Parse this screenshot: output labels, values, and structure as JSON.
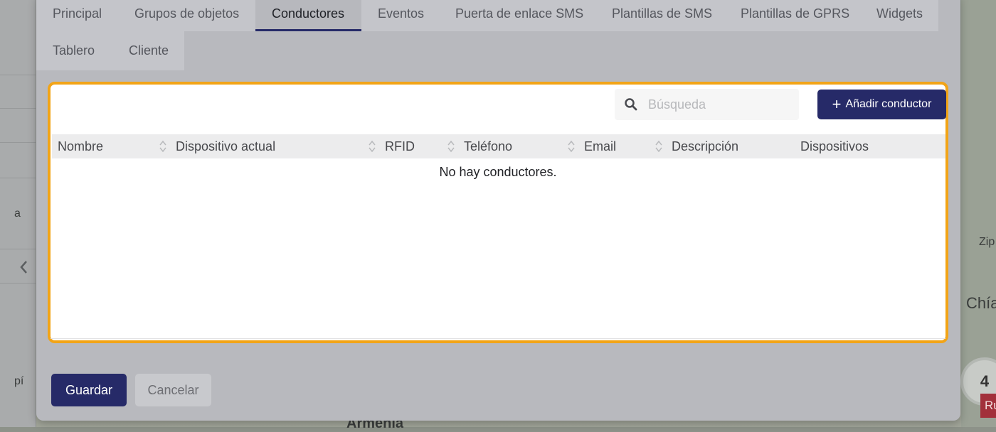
{
  "tabs_row1": [
    {
      "label": "Principal",
      "active": false
    },
    {
      "label": "Grupos de objetos",
      "active": false
    },
    {
      "label": "Conductores",
      "active": true
    },
    {
      "label": "Eventos",
      "active": false
    },
    {
      "label": "Puerta de enlace SMS",
      "active": false
    },
    {
      "label": "Plantillas de SMS",
      "active": false
    },
    {
      "label": "Plantillas de GPRS",
      "active": false
    },
    {
      "label": "Widgets",
      "active": false
    }
  ],
  "tabs_row2": [
    {
      "label": "Tablero",
      "active": false
    },
    {
      "label": "Cliente",
      "active": false
    }
  ],
  "search": {
    "placeholder": "Búsqueda",
    "value": ""
  },
  "add_button": {
    "label": "Añadir conductor"
  },
  "table": {
    "columns": [
      "Nombre",
      "Dispositivo actual",
      "RFID",
      "Teléfono",
      "Email",
      "Descripción",
      "Dispositivos"
    ],
    "empty_message": "No hay conductores."
  },
  "footer": {
    "save_label": "Guardar",
    "cancel_label": "Cancelar"
  },
  "background_map": {
    "labels": [
      "Zip",
      "Chía",
      "Armenia",
      "a",
      "pí"
    ],
    "cluster_count": "4",
    "tag_text": "Ru"
  },
  "colors": {
    "accent": "#262a68",
    "highlight": "#f2a417"
  },
  "icons": {
    "search": "search-icon",
    "add": "plus-icon",
    "sort": "sort-icon",
    "collapse": "chevron-left-icon"
  }
}
